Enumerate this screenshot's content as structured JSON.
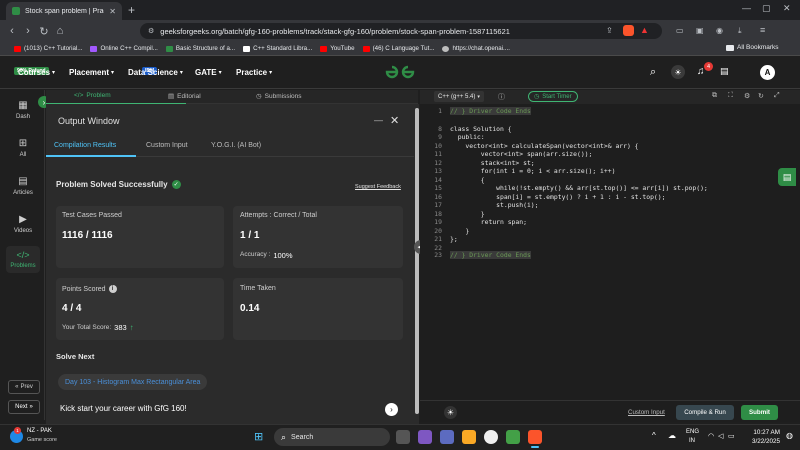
{
  "browser": {
    "tab_title": "Stock span problem | Practice |",
    "url": "geeksforgeeks.org/batch/gfg-160-problems/track/stack-gfg-160/problem/stock-span-problem-1587115621",
    "bookmarks": [
      {
        "label": "(1013) C++ Tutorial...",
        "color": "#ff0000"
      },
      {
        "label": "Online C++ Compil...",
        "color": "#a259ff"
      },
      {
        "label": "Basic Structure of a...",
        "color": "#2f8d46"
      },
      {
        "label": "C++ Standard Libra...",
        "color": "#ffffff"
      },
      {
        "label": "YouTube",
        "color": "#ff0000"
      },
      {
        "label": "(46) C Language Tut...",
        "color": "#ff0000"
      },
      {
        "label": "https://chat.openai....",
        "color": "#bdbdbd"
      }
    ],
    "all_bookmarks": "All Bookmarks"
  },
  "header": {
    "courses": "Courses",
    "courses_badge": "90% Refund",
    "placement": "Placement",
    "data_science": "Data Science",
    "data_science_badge": "IBM",
    "gate": "GATE",
    "practice": "Practice",
    "notif_count": "4",
    "avatar": "A"
  },
  "sidebar": {
    "dash": "Dash",
    "all": "All",
    "articles": "Articles",
    "videos": "Videos",
    "problems": "Problems",
    "prev": "Prev",
    "next": "Next"
  },
  "left_tabs": {
    "problem": "Problem",
    "editorial": "Editorial",
    "submissions": "Submissions"
  },
  "output": {
    "title": "Output Window",
    "tabs": [
      "Compilation Results",
      "Custom Input",
      "Y.O.G.I. (AI Bot)"
    ],
    "status": "Problem Solved Successfully",
    "feedback": "Suggest Feedback",
    "test_cases_label": "Test Cases Passed",
    "test_cases_value": "1116 / 1116",
    "attempts_label": "Attempts : Correct / Total",
    "attempts_value": "1 / 1",
    "accuracy_label": "Accuracy :",
    "accuracy_value": "100%",
    "points_label": "Points Scored",
    "points_value": "4 / 4",
    "total_score_label": "Your Total Score:",
    "total_score_value": "383",
    "time_label": "Time Taken",
    "time_value": "0.14",
    "solve_next": "Solve Next",
    "next_problem": "Day 103 - Histogram Max Rectangular Area",
    "kickstart": "Kick start your career with GfG 160!"
  },
  "editor": {
    "language": "C++ (g++ 5.4)",
    "timer": "Start Timer",
    "custom_input": "Custom Input",
    "compile_run": "Compile & Run",
    "submit": "Submit",
    "lines": [
      {
        "n": "1",
        "code": "// } Driver Code Ends"
      },
      {
        "n": "8",
        "code": "class Solution {"
      },
      {
        "n": "9",
        "code": "  public:"
      },
      {
        "n": "10",
        "code": "    vector<int> calculateSpan(vector<int>& arr) {"
      },
      {
        "n": "11",
        "code": "        vector<int> span(arr.size());"
      },
      {
        "n": "12",
        "code": "        stack<int> st;"
      },
      {
        "n": "13",
        "code": "        for(int i = 0; i < arr.size(); i++)"
      },
      {
        "n": "14",
        "code": "        {"
      },
      {
        "n": "15",
        "code": "            while(!st.empty() && arr[st.top()] <= arr[i]) st.pop();"
      },
      {
        "n": "16",
        "code": "            span[i] = st.empty() ? i + 1 : i - st.top();"
      },
      {
        "n": "17",
        "code": "            st.push(i);"
      },
      {
        "n": "18",
        "code": "        }"
      },
      {
        "n": "19",
        "code": "        return span;"
      },
      {
        "n": "20",
        "code": "    }"
      },
      {
        "n": "21",
        "code": "};"
      },
      {
        "n": "22",
        "code": ""
      },
      {
        "n": "23",
        "code": "// } Driver Code Ends"
      }
    ]
  },
  "taskbar": {
    "weather_title": "NZ - PAK",
    "weather_sub": "Game score",
    "search": "Search",
    "lang1": "ENG",
    "lang2": "IN",
    "time": "10:27 AM",
    "date": "3/22/2025"
  }
}
